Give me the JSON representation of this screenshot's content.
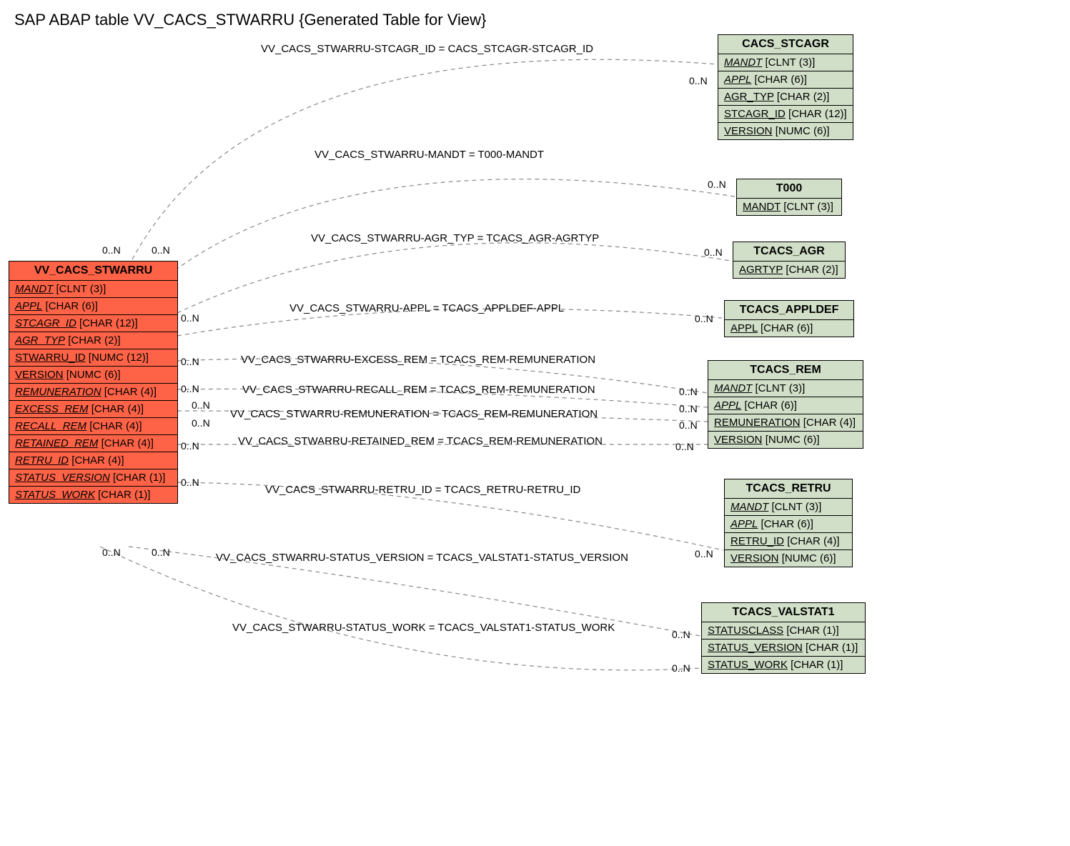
{
  "title": "SAP ABAP table VV_CACS_STWARRU {Generated Table for View}",
  "main_table": {
    "name": "VV_CACS_STWARRU",
    "fields": [
      {
        "name": "MANDT",
        "type": "[CLNT (3)]",
        "italic": true
      },
      {
        "name": "APPL",
        "type": "[CHAR (6)]",
        "italic": true
      },
      {
        "name": "STCAGR_ID",
        "type": "[CHAR (12)]",
        "italic": true
      },
      {
        "name": "AGR_TYP",
        "type": "[CHAR (2)]",
        "italic": true
      },
      {
        "name": "STWARRU_ID",
        "type": "[NUMC (12)]",
        "italic": false
      },
      {
        "name": "VERSION",
        "type": "[NUMC (6)]",
        "italic": false
      },
      {
        "name": "REMUNERATION",
        "type": "[CHAR (4)]",
        "italic": true
      },
      {
        "name": "EXCESS_REM",
        "type": "[CHAR (4)]",
        "italic": true
      },
      {
        "name": "RECALL_REM",
        "type": "[CHAR (4)]",
        "italic": true
      },
      {
        "name": "RETAINED_REM",
        "type": "[CHAR (4)]",
        "italic": true
      },
      {
        "name": "RETRU_ID",
        "type": "[CHAR (4)]",
        "italic": true
      },
      {
        "name": "STATUS_VERSION",
        "type": "[CHAR (1)]",
        "italic": true
      },
      {
        "name": "STATUS_WORK",
        "type": "[CHAR (1)]",
        "italic": true
      }
    ]
  },
  "ref_tables": {
    "cacs_stcagr": {
      "name": "CACS_STCAGR",
      "fields": [
        {
          "name": "MANDT",
          "type": "[CLNT (3)]",
          "italic": true
        },
        {
          "name": "APPL",
          "type": "[CHAR (6)]",
          "italic": true
        },
        {
          "name": "AGR_TYP",
          "type": "[CHAR (2)]",
          "italic": false
        },
        {
          "name": "STCAGR_ID",
          "type": "[CHAR (12)]",
          "italic": false
        },
        {
          "name": "VERSION",
          "type": "[NUMC (6)]",
          "italic": false
        }
      ]
    },
    "t000": {
      "name": "T000",
      "fields": [
        {
          "name": "MANDT",
          "type": "[CLNT (3)]",
          "italic": false
        }
      ]
    },
    "tcacs_agr": {
      "name": "TCACS_AGR",
      "fields": [
        {
          "name": "AGRTYP",
          "type": "[CHAR (2)]",
          "italic": false
        }
      ]
    },
    "tcacs_appldef": {
      "name": "TCACS_APPLDEF",
      "fields": [
        {
          "name": "APPL",
          "type": "[CHAR (6)]",
          "italic": false
        }
      ]
    },
    "tcacs_rem": {
      "name": "TCACS_REM",
      "fields": [
        {
          "name": "MANDT",
          "type": "[CLNT (3)]",
          "italic": true
        },
        {
          "name": "APPL",
          "type": "[CHAR (6)]",
          "italic": true
        },
        {
          "name": "REMUNERATION",
          "type": "[CHAR (4)]",
          "italic": false
        },
        {
          "name": "VERSION",
          "type": "[NUMC (6)]",
          "italic": false
        }
      ]
    },
    "tcacs_retru": {
      "name": "TCACS_RETRU",
      "fields": [
        {
          "name": "MANDT",
          "type": "[CLNT (3)]",
          "italic": true
        },
        {
          "name": "APPL",
          "type": "[CHAR (6)]",
          "italic": true
        },
        {
          "name": "RETRU_ID",
          "type": "[CHAR (4)]",
          "italic": false
        },
        {
          "name": "VERSION",
          "type": "[NUMC (6)]",
          "italic": false
        }
      ]
    },
    "tcacs_valstat1": {
      "name": "TCACS_VALSTAT1",
      "fields": [
        {
          "name": "STATUSCLASS",
          "type": "[CHAR (1)]",
          "italic": false
        },
        {
          "name": "STATUS_VERSION",
          "type": "[CHAR (1)]",
          "italic": false
        },
        {
          "name": "STATUS_WORK",
          "type": "[CHAR (1)]",
          "italic": false
        }
      ]
    }
  },
  "relations": [
    {
      "label": "VV_CACS_STWARRU-STCAGR_ID = CACS_STCAGR-STCAGR_ID"
    },
    {
      "label": "VV_CACS_STWARRU-MANDT = T000-MANDT"
    },
    {
      "label": "VV_CACS_STWARRU-AGR_TYP = TCACS_AGR-AGRTYP"
    },
    {
      "label": "VV_CACS_STWARRU-APPL = TCACS_APPLDEF-APPL"
    },
    {
      "label": "VV_CACS_STWARRU-EXCESS_REM = TCACS_REM-REMUNERATION"
    },
    {
      "label": "VV_CACS_STWARRU-RECALL_REM = TCACS_REM-REMUNERATION"
    },
    {
      "label": "VV_CACS_STWARRU-REMUNERATION = TCACS_REM-REMUNERATION"
    },
    {
      "label": "VV_CACS_STWARRU-RETAINED_REM = TCACS_REM-REMUNERATION"
    },
    {
      "label": "VV_CACS_STWARRU-RETRU_ID = TCACS_RETRU-RETRU_ID"
    },
    {
      "label": "VV_CACS_STWARRU-STATUS_VERSION = TCACS_VALSTAT1-STATUS_VERSION"
    },
    {
      "label": "VV_CACS_STWARRU-STATUS_WORK = TCACS_VALSTAT1-STATUS_WORK"
    }
  ],
  "cardinality": "0..N"
}
